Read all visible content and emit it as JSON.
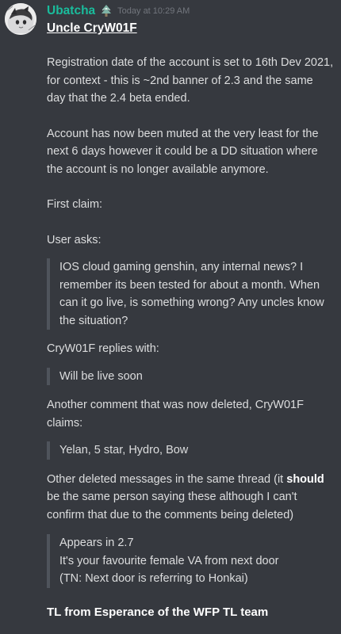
{
  "message": {
    "author": "Ubatcha",
    "timestamp": "Today at 10:29 AM",
    "role_icon": "tree-sprite-icon",
    "avatar_icon": "anime-avatar-icon",
    "title": "Uncle CryW01F",
    "paragraphs": {
      "registration": "Registration date of the account is set to 16th Dev 2021, for context - this is ~2nd banner of 2.3 and the same day that the 2.4 beta ended.",
      "muted": "Account has now been muted at the very least for the next 6 days however it could be a DD situation where the account is no longer available anymore.",
      "first_claim": "First claim:",
      "user_asks": "User asks:",
      "quote_question": "IOS cloud gaming genshin, any internal news? I remember its been tested for about a month. When can it go live, is something wrong? Any uncles know the situation?",
      "replies_with": "CryW01F replies with:",
      "quote_reply": "Will be live soon",
      "another_comment": "Another comment that was now deleted, CryW01F claims:",
      "quote_claim": "Yelan, 5 star, Hydro, Bow",
      "other_deleted_before": "Other deleted messages in the same thread (it ",
      "other_deleted_bold": "should",
      "other_deleted_after": " be the same person saying these although I can't confirm that due to the comments being deleted)",
      "quote_appears_1": "Appears in 2.7",
      "quote_appears_2": "It's your favourite female VA from next door",
      "quote_appears_3": "(TN: Next door is referring to Honkai)"
    },
    "footer": "TL from Esperance of the WFP TL team"
  },
  "colors": {
    "background": "#36393f",
    "username": "#1abc9c",
    "text": "#dcddde",
    "timestamp": "#72767d",
    "quote_bar": "#4f545c"
  }
}
